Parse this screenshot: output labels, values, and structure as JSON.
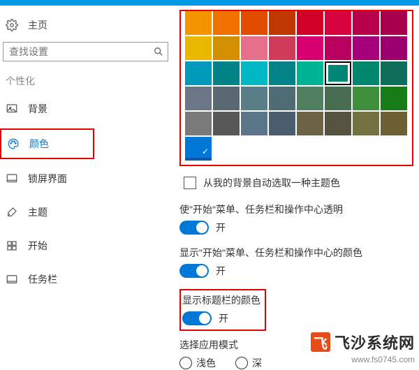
{
  "header": {
    "home": "主页"
  },
  "search": {
    "placeholder": "查找设置"
  },
  "sidebar": {
    "section": "个性化",
    "items": [
      {
        "label": "背景"
      },
      {
        "label": "颜色"
      },
      {
        "label": "锁屏界面"
      },
      {
        "label": "主题"
      },
      {
        "label": "开始"
      },
      {
        "label": "任务栏"
      }
    ]
  },
  "palette": {
    "colors": [
      [
        "#f49500",
        "#f07000",
        "#e34c00",
        "#c13700",
        "#cf0029",
        "#d8003e",
        "#b8004a",
        "#a8004a"
      ],
      [
        "#e8b800",
        "#d29000",
        "#e66f8b",
        "#d03b5a",
        "#d7006e",
        "#b8005e",
        "#a4007c",
        "#9b006e"
      ],
      [
        "#0099bc",
        "#008287",
        "#00b7c3",
        "#038387",
        "#00b294",
        "#018574",
        "#00876e",
        "#0f6e5a"
      ],
      [
        "#6b7785",
        "#5a6872",
        "#5a7d8a",
        "#4f6b74",
        "#508060",
        "#486e52",
        "#3f8f3f",
        "#177b17"
      ],
      [
        "#7a7a7a",
        "#585858",
        "#5b748a",
        "#4a5d6e",
        "#6a6346",
        "#565140",
        "#737140",
        "#6b5f34"
      ]
    ],
    "selected_row": 2,
    "selected_col": 5,
    "accent": "#0078d7"
  },
  "options": {
    "auto_pick_label": "从我的背景自动选取一种主题色",
    "transparent": {
      "label": "使\"开始\"菜单、任务栏和操作中心透明",
      "state": "开"
    },
    "show_start_color": {
      "label": "显示\"开始\"菜单、任务栏和操作中心的颜色",
      "state": "开"
    },
    "titlebar_color": {
      "label": "显示标题栏的颜色",
      "state": "开"
    },
    "mode": {
      "label": "选择应用模式",
      "light": "浅色",
      "dark": "深"
    }
  },
  "watermark": {
    "title": "飞沙系统网",
    "url": "www.fs0745.com"
  }
}
